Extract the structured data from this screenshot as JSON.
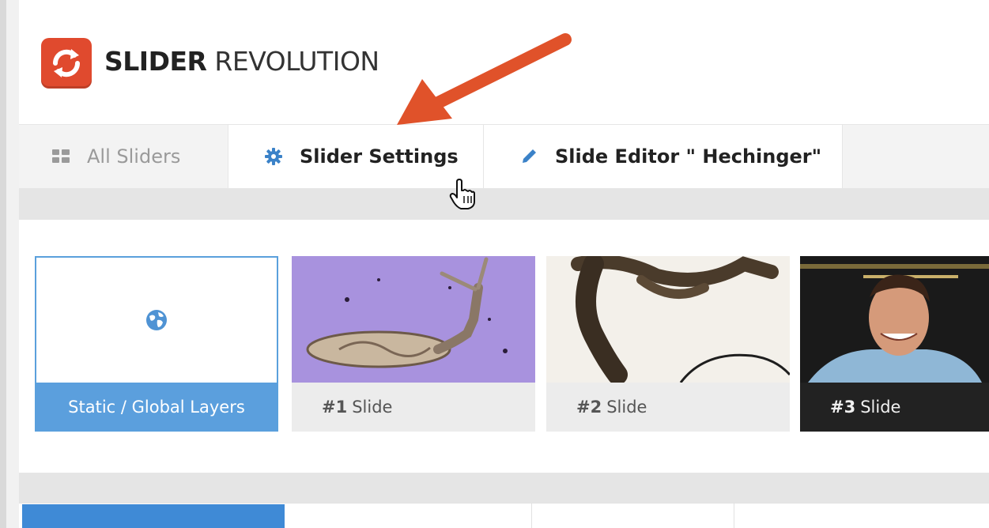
{
  "brand": {
    "bold": "SLIDER",
    "light": " REVOLUTION"
  },
  "tabs": [
    {
      "label": "All Sliders",
      "icon": "grid-icon"
    },
    {
      "label": "Slider Settings",
      "icon": "gear-icon"
    },
    {
      "label": "Slide Editor \" Hechinger\"",
      "icon": "pencil-icon"
    }
  ],
  "slides": [
    {
      "label": "Static / Global Layers",
      "icon": "globe-icon"
    },
    {
      "num": "#1",
      "label": "Slide"
    },
    {
      "num": "#2",
      "label": "Slide"
    },
    {
      "num": "#3",
      "label": "Slide"
    }
  ],
  "colors": {
    "brand_red": "#e04a2e",
    "accent_blue": "#5b9fdd",
    "arrow_orange": "#e0522a"
  }
}
